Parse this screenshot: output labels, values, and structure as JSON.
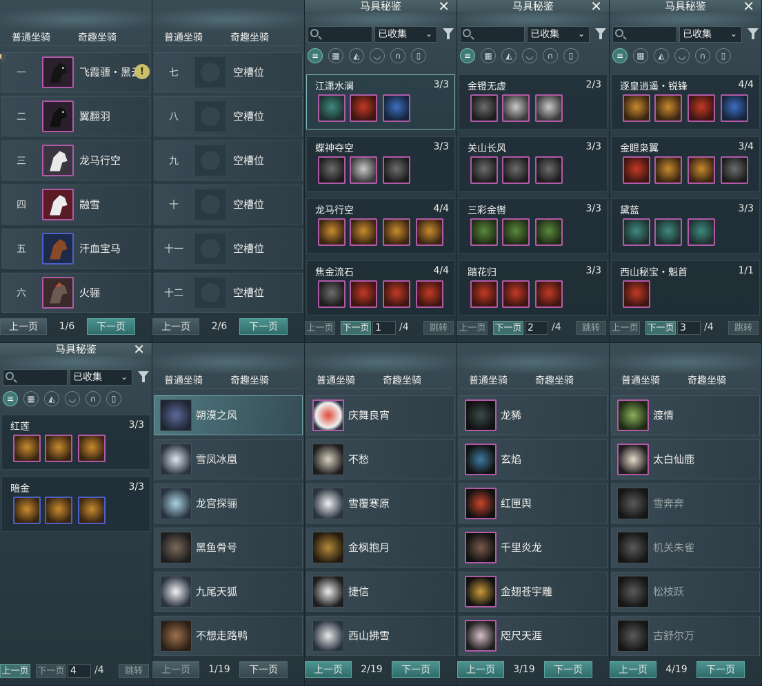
{
  "tabs": {
    "normal": "普通坐骑",
    "fun": "奇趣坐骑"
  },
  "buttons": {
    "prev": "上一页",
    "next": "下一页",
    "jump": "跳转"
  },
  "dialog_title": "马具秘鉴",
  "filter_select": "已收集",
  "empty_slot": "空槽位",
  "slots_page1": {
    "page": "1/6",
    "rows": [
      {
        "num": "一",
        "name": "飞霞骠・黑云"
      },
      {
        "num": "二",
        "name": "翼翻羽"
      },
      {
        "num": "三",
        "name": "龙马行空"
      },
      {
        "num": "四",
        "name": "融雪"
      },
      {
        "num": "五",
        "name": "汗血宝马"
      },
      {
        "num": "六",
        "name": "火骊"
      }
    ]
  },
  "slots_page2": {
    "page": "2/6",
    "rows": [
      {
        "num": "七",
        "name": "空槽位"
      },
      {
        "num": "八",
        "name": "空槽位"
      },
      {
        "num": "九",
        "name": "空槽位"
      },
      {
        "num": "十",
        "name": "空槽位"
      },
      {
        "num": "十一",
        "name": "空槽位"
      },
      {
        "num": "十二",
        "name": "空槽位"
      }
    ]
  },
  "codex_page1": {
    "page_input": "1",
    "page_total": "/4",
    "sets": [
      {
        "name": "江潇水澜",
        "count": "3/3"
      },
      {
        "name": "蝶神夺空",
        "count": "3/3"
      },
      {
        "name": "龙马行空",
        "count": "4/4"
      },
      {
        "name": "焦金流石",
        "count": "4/4"
      }
    ]
  },
  "codex_page2": {
    "page_input": "2",
    "page_total": "/4",
    "sets": [
      {
        "name": "金镫无虚",
        "count": "2/3"
      },
      {
        "name": "关山长风",
        "count": "3/3"
      },
      {
        "name": "三彩金辔",
        "count": "3/3"
      },
      {
        "name": "踏花归",
        "count": "3/3"
      }
    ]
  },
  "codex_page3": {
    "page_input": "3",
    "page_total": "/4",
    "sets": [
      {
        "name": "逐皇逍遥・锐锋",
        "count": "4/4"
      },
      {
        "name": "金眼枭翼",
        "count": "3/4"
      },
      {
        "name": "黛蓝",
        "count": "3/3"
      },
      {
        "name": "西山秘宝・魁首",
        "count": "1/1"
      }
    ]
  },
  "codex_page4": {
    "page_input": "4",
    "page_total": "/4",
    "sets": [
      {
        "name": "红莲",
        "count": "3/3"
      },
      {
        "name": "暗金",
        "count": "3/3"
      }
    ]
  },
  "fun_page1": {
    "page": "1/19",
    "rows": [
      {
        "name": "朔漠之风"
      },
      {
        "name": "雪凤冰凰"
      },
      {
        "name": "龙宫探骊"
      },
      {
        "name": "黑鱼骨号"
      },
      {
        "name": "九尾天狐"
      },
      {
        "name": "不想走路鸭"
      }
    ]
  },
  "fun_page2": {
    "page": "2/19",
    "rows": [
      {
        "name": "庆舞良宵"
      },
      {
        "name": "不愁"
      },
      {
        "name": "雪覆寒原"
      },
      {
        "name": "金枫抱月"
      },
      {
        "name": "捷信"
      },
      {
        "name": "西山拂雪"
      }
    ]
  },
  "fun_page3": {
    "page": "3/19",
    "rows": [
      {
        "name": "龙豨"
      },
      {
        "name": "玄焰"
      },
      {
        "name": "红匣舆"
      },
      {
        "name": "千里炎龙"
      },
      {
        "name": "金翅苍宇雕"
      },
      {
        "name": "咫尺天涯"
      }
    ]
  },
  "fun_page4": {
    "page": "4/19",
    "rows": [
      {
        "name": "渡情"
      },
      {
        "name": "太白仙鹿"
      },
      {
        "name": "雪奔奔"
      },
      {
        "name": "机关朱雀"
      },
      {
        "name": "松枝跃"
      },
      {
        "name": "古舒尔万"
      }
    ]
  },
  "icons": [
    "list-icon",
    "grid-icon",
    "saddle-icon",
    "breastplate-icon",
    "horseshoe-icon",
    "armor-icon"
  ],
  "colors": {
    "accent": "#3f7a77",
    "rare_border": "#b25aa8",
    "uncommon_border": "#4b61c9"
  }
}
